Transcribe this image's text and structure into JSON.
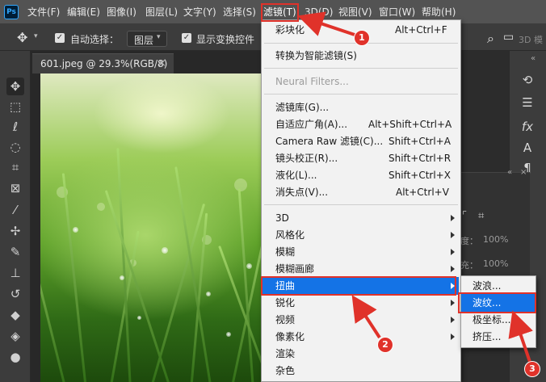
{
  "app": {
    "logo": "Ps"
  },
  "menubar": {
    "file": "文件(F)",
    "edit": "编辑(E)",
    "image": "图像(I)",
    "layer": "图层(L)",
    "type": "文字(Y)",
    "select": "选择(S)",
    "filter": "滤镜(T)",
    "3d": "3D(D)",
    "view": "视图(V)",
    "window": "窗口(W)",
    "help": "帮助(H)"
  },
  "options": {
    "auto_select_label": "自动选择：",
    "layer_select_value": "图层",
    "show_transform_label": "显示变换控件",
    "right_text": "3D 模"
  },
  "document": {
    "tab_title": "601.jpeg @ 29.3%(RGB/8)",
    "close_glyph": "×"
  },
  "filter_menu": {
    "last_filter": {
      "label": "彩块化",
      "shortcut": "Alt+Ctrl+F"
    },
    "convert_smart": {
      "label": "转换为智能滤镜(S)"
    },
    "neural_filters": {
      "label": "Neural Filters..."
    },
    "gallery": {
      "label": "滤镜库(G)..."
    },
    "adaptive_wide": {
      "label": "自适应广角(A)...",
      "shortcut": "Alt+Shift+Ctrl+A"
    },
    "camera_raw": {
      "label": "Camera Raw 滤镜(C)...",
      "shortcut": "Shift+Ctrl+A"
    },
    "lens_correction": {
      "label": "镜头校正(R)...",
      "shortcut": "Shift+Ctrl+R"
    },
    "liquify": {
      "label": "液化(L)...",
      "shortcut": "Shift+Ctrl+X"
    },
    "vanishing_point": {
      "label": "消失点(V)...",
      "shortcut": "Alt+Ctrl+V"
    },
    "sub_3d": "3D",
    "stylize": "风格化",
    "blur": "模糊",
    "blur_gallery": "模糊画廊",
    "distort": "扭曲",
    "sharpen": "锐化",
    "video": "视频",
    "pixelate": "像素化",
    "render": "渲染",
    "other": "杂色"
  },
  "distort_submenu": {
    "wave": "波浪...",
    "ripple": "波纹...",
    "polar": "极坐标...",
    "pinch": "挤压..."
  },
  "panel": {
    "opacity_label": "度：",
    "opacity_value": "100%",
    "fill_label": "充：",
    "fill_value": "100%"
  },
  "annotations": {
    "step1": "1",
    "step2": "2",
    "step3": "3",
    "color": "#e0322a"
  },
  "colors": {
    "highlight": "#1473e6",
    "menubar": "#535353",
    "toolbar": "#3c3c3c"
  },
  "icons": {
    "tools": [
      "move-tool-icon",
      "marquee-tool-icon",
      "lasso-tool-icon",
      "quick-select-tool-icon",
      "crop-tool-icon",
      "frame-tool-icon",
      "eyedropper-tool-icon",
      "healing-tool-icon",
      "brush-tool-icon",
      "stamp-tool-icon",
      "history-brush-tool-icon",
      "eraser-tool-icon",
      "gradient-tool-icon",
      "blur-tool-icon"
    ],
    "right": [
      "history-icon",
      "adjustments-icon",
      "fx-icon",
      "character-icon",
      "paragraph-icon"
    ]
  }
}
